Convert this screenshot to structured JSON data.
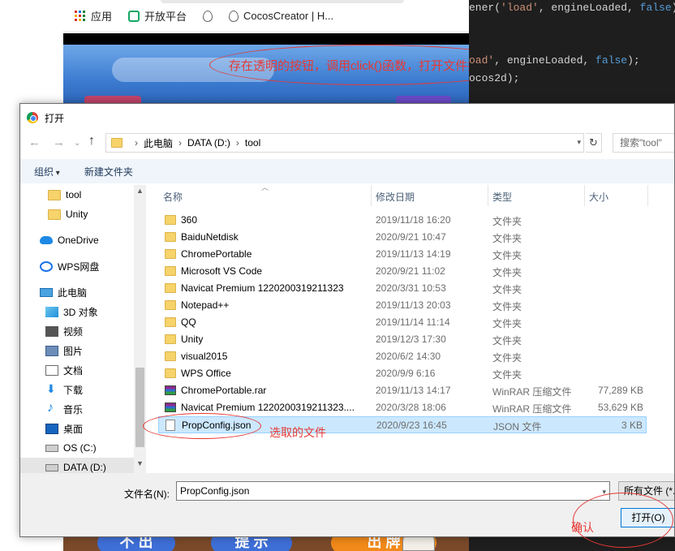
{
  "code_editor": {
    "line1": {
      "fn": "ener(",
      "str": "'load'",
      "rest": ", engineLoaded, ",
      "kw": "false",
      "end": ");"
    },
    "line2": {
      "fn": "",
      "str": "oad'",
      "rest": ", engineLoaded, ",
      "kw": "false",
      "end": ");"
    },
    "line3": {
      "text": "ocos2d);"
    }
  },
  "browser": {
    "bookmarks": [
      {
        "label": "应用",
        "icon": "apps-grid-icon"
      },
      {
        "label": "开放平台",
        "icon": "open-platform-icon"
      },
      {
        "label": "",
        "icon": "drop-icon"
      },
      {
        "label": "CocosCreator | H...",
        "icon": "cocos-drop-icon"
      }
    ]
  },
  "annotations": {
    "top": "存在透明的按钮，调用click()函数，打开文件操作",
    "selected_file": "选取的文件",
    "confirm": "确认"
  },
  "game_buttons": [
    "不 出",
    "提 示",
    "出 牌"
  ],
  "dialog": {
    "title": "打开",
    "address": [
      "此电脑",
      "DATA (D:)",
      "tool"
    ],
    "search_placeholder": "搜索\"tool\"",
    "organize": "组织",
    "new_folder": "新建文件夹",
    "nav_items": [
      {
        "label": "tool",
        "icon": "folder-icon"
      },
      {
        "label": "Unity",
        "icon": "folder-icon"
      },
      {
        "label": "OneDrive",
        "icon": "onedrive-cloud-icon"
      },
      {
        "label": "WPS网盘",
        "icon": "wps-cloud-icon"
      },
      {
        "label": "此电脑",
        "icon": "this-pc-icon"
      },
      {
        "label": "3D 对象",
        "icon": "3d-objects-icon"
      },
      {
        "label": "视频",
        "icon": "video-icon"
      },
      {
        "label": "图片",
        "icon": "pictures-icon"
      },
      {
        "label": "文档",
        "icon": "documents-icon"
      },
      {
        "label": "下载",
        "icon": "download-icon"
      },
      {
        "label": "音乐",
        "icon": "music-icon"
      },
      {
        "label": "桌面",
        "icon": "desktop-icon"
      },
      {
        "label": "OS (C:)",
        "icon": "drive-c-icon"
      },
      {
        "label": "DATA (D:)",
        "icon": "drive-d-icon"
      }
    ],
    "columns": {
      "name": "名称",
      "date": "修改日期",
      "type": "类型",
      "size": "大小"
    },
    "files": [
      {
        "name": "360",
        "date": "2019/11/18 16:20",
        "type": "文件夹",
        "size": "",
        "icon": "folder-icon"
      },
      {
        "name": "BaiduNetdisk",
        "date": "2020/9/21 10:47",
        "type": "文件夹",
        "size": "",
        "icon": "folder-icon"
      },
      {
        "name": "ChromePortable",
        "date": "2019/11/13 14:19",
        "type": "文件夹",
        "size": "",
        "icon": "folder-icon"
      },
      {
        "name": "Microsoft VS Code",
        "date": "2020/9/21 11:02",
        "type": "文件夹",
        "size": "",
        "icon": "folder-icon"
      },
      {
        "name": "Navicat Premium 1220200319211323",
        "date": "2020/3/31 10:53",
        "type": "文件夹",
        "size": "",
        "icon": "folder-icon"
      },
      {
        "name": "Notepad++",
        "date": "2019/11/13 20:03",
        "type": "文件夹",
        "size": "",
        "icon": "folder-icon"
      },
      {
        "name": "QQ",
        "date": "2019/11/14 11:14",
        "type": "文件夹",
        "size": "",
        "icon": "folder-icon"
      },
      {
        "name": "Unity",
        "date": "2019/12/3 17:30",
        "type": "文件夹",
        "size": "",
        "icon": "folder-icon"
      },
      {
        "name": "visual2015",
        "date": "2020/6/2 14:30",
        "type": "文件夹",
        "size": "",
        "icon": "folder-icon"
      },
      {
        "name": "WPS Office",
        "date": "2020/9/9 6:16",
        "type": "文件夹",
        "size": "",
        "icon": "folder-icon"
      },
      {
        "name": "ChromePortable.rar",
        "date": "2019/11/13 14:17",
        "type": "WinRAR 压缩文件",
        "size": "77,289 KB",
        "icon": "rar-archive-icon"
      },
      {
        "name": "Navicat Premium 1220200319211323....",
        "date": "2020/3/28 18:06",
        "type": "WinRAR 压缩文件",
        "size": "53,629 KB",
        "icon": "rar-archive-icon"
      },
      {
        "name": "PropConfig.json",
        "date": "2020/9/23 16:45",
        "type": "JSON 文件",
        "size": "3 KB",
        "icon": "json-file-icon"
      }
    ],
    "filename_label": "文件名(N):",
    "filename_value": "PropConfig.json",
    "filetype": "所有文件 (*.*)",
    "open_button": "打开(O)"
  }
}
